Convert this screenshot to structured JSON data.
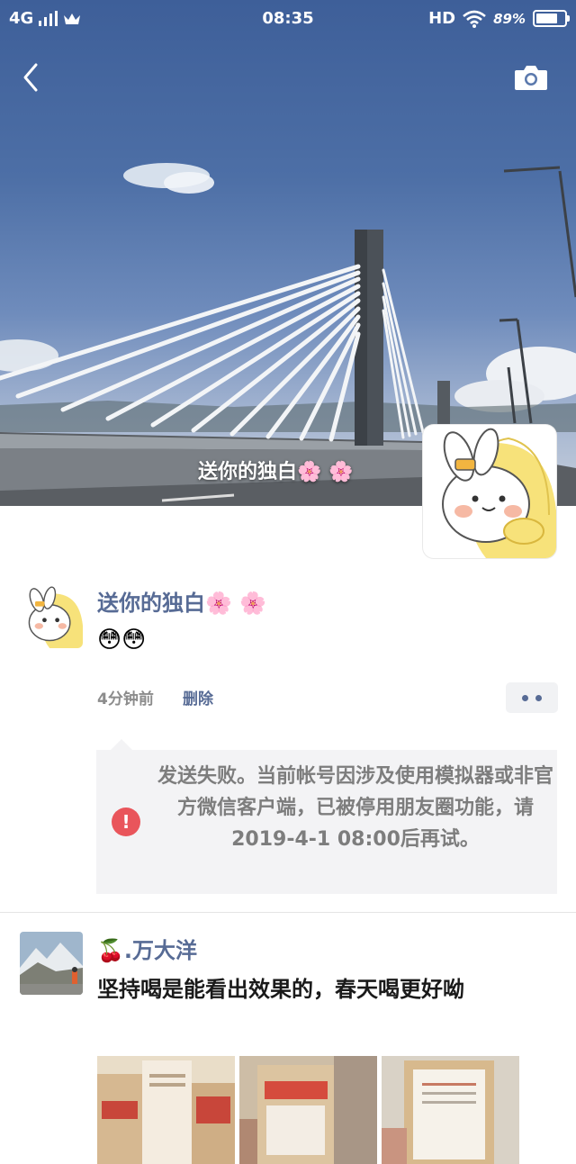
{
  "status_bar": {
    "network": "4G",
    "time": "08:35",
    "hd": "HD",
    "battery": "89%",
    "battery_level": 0.89
  },
  "cover": {
    "user_name": "送你的独白🌸 🌸"
  },
  "posts": [
    {
      "author": "送你的独白🌸 🌸",
      "text": "😳😳",
      "time": "4分钟前",
      "delete_label": "删除",
      "error_message": "发送失败。当前帐号因涉及使用模拟器或非官方微信客户端，已被停用朋友圈功能，请2019-4-1 08:00后再试。"
    },
    {
      "author": "🍒.万大洋",
      "text": "坚持喝是能看出效果的，春天喝更好呦"
    }
  ],
  "icons": {
    "back": "chevron-left-icon",
    "camera": "camera-icon",
    "more": "more-dots-icon",
    "error": "exclamation-icon"
  },
  "colors": {
    "name_link": "#576b95",
    "error_red": "#e9555b",
    "fail_box_bg": "#f3f3f5"
  }
}
